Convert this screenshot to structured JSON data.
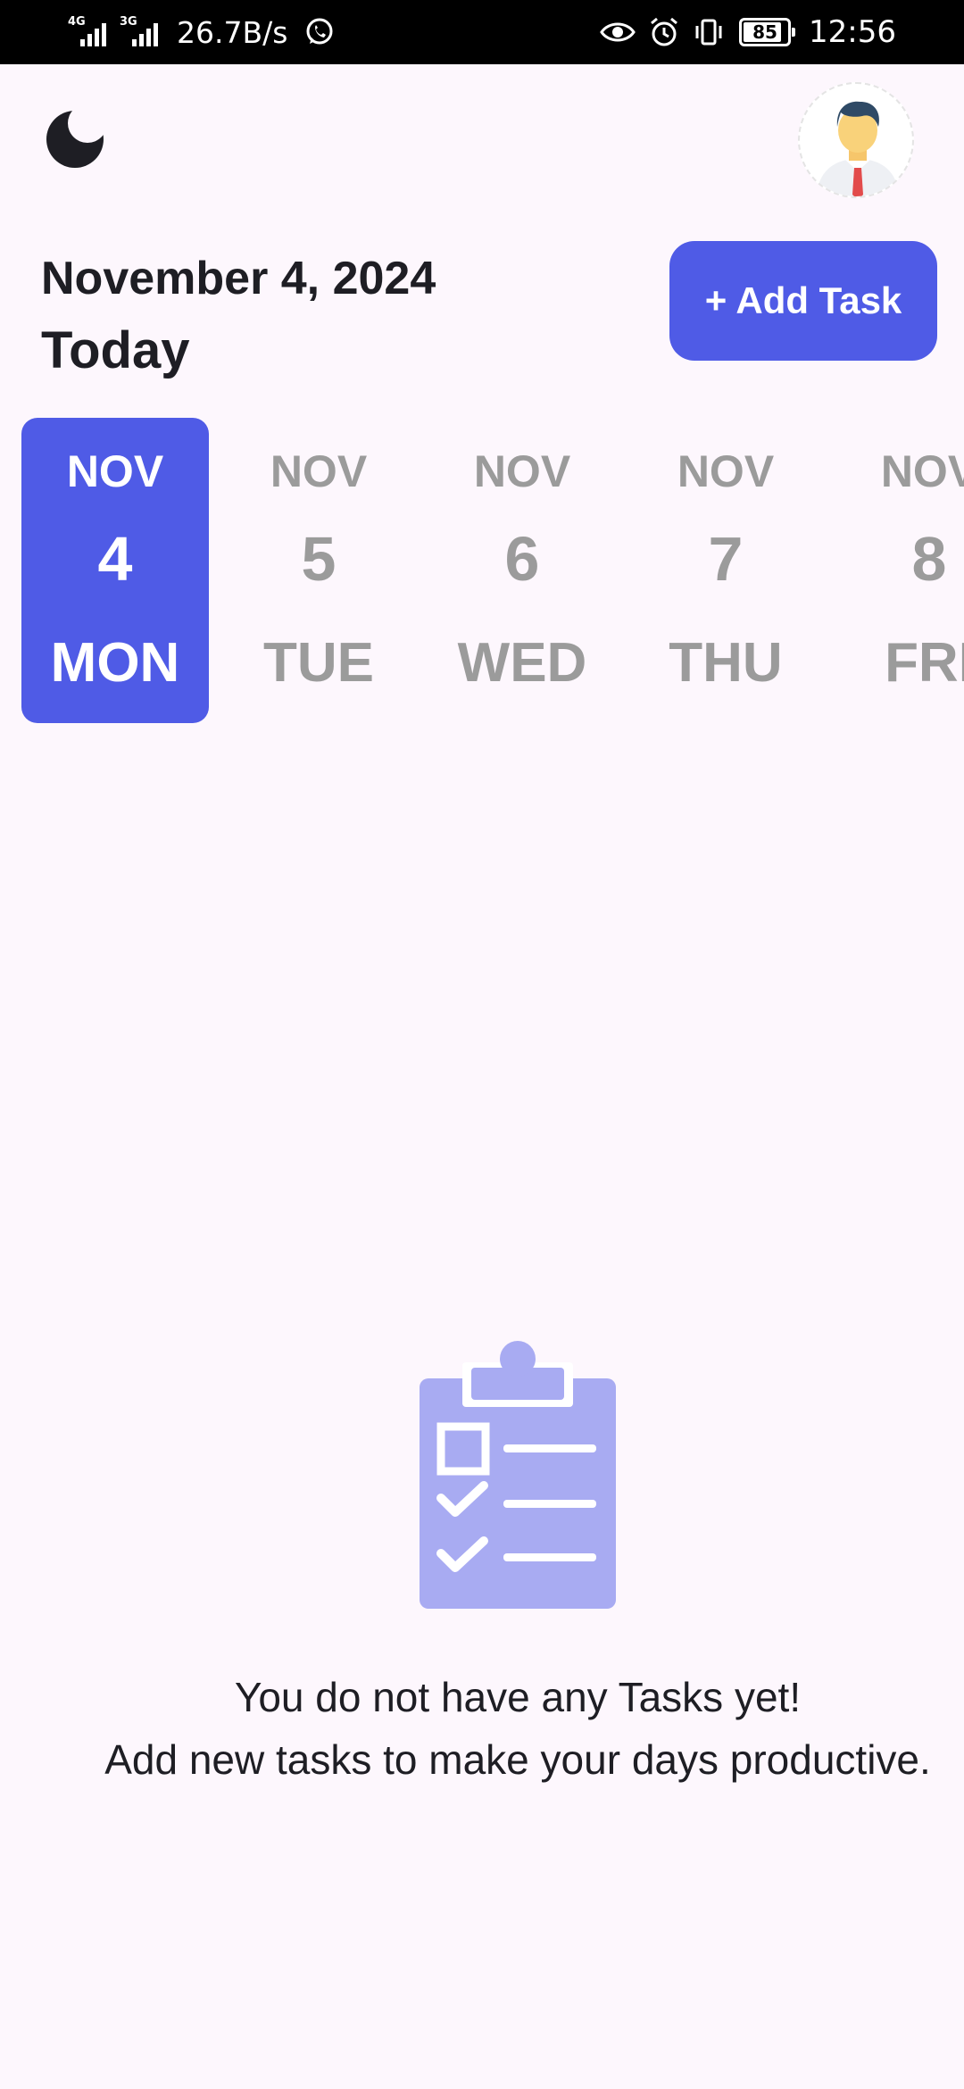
{
  "status_bar": {
    "signal_1_tag": "4G",
    "signal_2_tag": "3G",
    "net_speed": "26.7B/s",
    "battery": "85",
    "time": "12:56"
  },
  "header": {
    "date": "November 4, 2024",
    "today_label": "Today",
    "add_task_label": "+ Add Task"
  },
  "date_strip": [
    {
      "month": "NOV",
      "day": "4",
      "weekday": "MON",
      "selected": true
    },
    {
      "month": "NOV",
      "day": "5",
      "weekday": "TUE",
      "selected": false
    },
    {
      "month": "NOV",
      "day": "6",
      "weekday": "WED",
      "selected": false
    },
    {
      "month": "NOV",
      "day": "7",
      "weekday": "THU",
      "selected": false
    },
    {
      "month": "NOV",
      "day": "8",
      "weekday": "FRI",
      "selected": false
    }
  ],
  "empty_state": {
    "line1": "You do not have any Tasks yet!",
    "line2": "Add new tasks to make your days productive."
  },
  "colors": {
    "accent": "#4f5be6",
    "icon_light": "#a8abf2",
    "background": "#fdf7fd",
    "inactive_text": "#9b9b9b"
  },
  "icons": [
    "moon-icon",
    "avatar-icon",
    "clipboard-checklist-icon",
    "whatsapp-icon",
    "eye-icon",
    "alarm-icon",
    "vibrate-icon",
    "battery-icon"
  ]
}
